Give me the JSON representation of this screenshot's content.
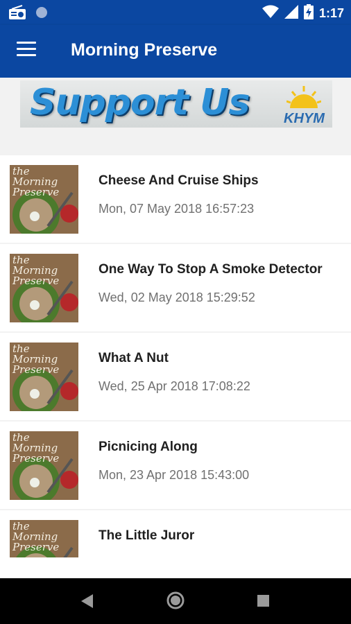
{
  "status_bar": {
    "time": "1:17",
    "icons": [
      "radio-icon",
      "circle-icon",
      "wifi-icon",
      "signal-icon",
      "battery-icon"
    ]
  },
  "app_bar": {
    "title": "Morning Preserve",
    "menu_icon": "menu-icon"
  },
  "banner": {
    "text": "Support Us",
    "logo_text": "KHYM"
  },
  "episodes": [
    {
      "title": "Cheese And Cruise Ships",
      "date": "Mon, 07 May 2018 16:57:23",
      "thumb_text": [
        "the",
        "Morning",
        "Preserve"
      ]
    },
    {
      "title": "One Way To Stop A Smoke Detector",
      "date": "Wed, 02 May 2018 15:29:52",
      "thumb_text": [
        "the",
        "Morning",
        "Preserve"
      ]
    },
    {
      "title": "What A Nut",
      "date": "Wed, 25 Apr 2018 17:08:22",
      "thumb_text": [
        "the",
        "Morning",
        "Preserve"
      ]
    },
    {
      "title": "Picnicing Along",
      "date": "Mon, 23 Apr 2018 15:43:00",
      "thumb_text": [
        "the",
        "Morning",
        "Preserve"
      ]
    },
    {
      "title": "The Little Juror",
      "date": "",
      "thumb_text": [
        "the",
        "Morning",
        "Preserve"
      ]
    }
  ],
  "nav_bar": {
    "buttons": [
      "back-icon",
      "home-icon",
      "recents-icon"
    ]
  },
  "colors": {
    "primary": "#0b47a1",
    "list_bg": "#f2f2f2",
    "title_text": "#202020",
    "date_text": "#707070"
  }
}
